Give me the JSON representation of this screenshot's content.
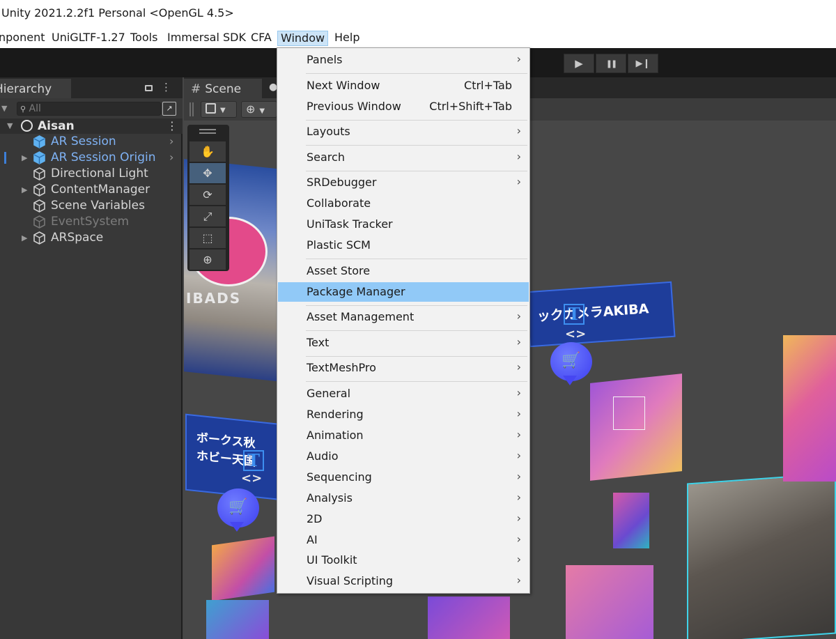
{
  "titlebar": {
    "title": "Unity 2021.2.2f1 Personal <OpenGL 4.5>"
  },
  "menubar": {
    "items": [
      "nponent",
      "UniGLTF-1.27",
      "Tools",
      "Immersal SDK",
      "CFA",
      "Window",
      "Help"
    ],
    "active": "Window"
  },
  "toolbar": {
    "play": "▶",
    "pause": "❚❚",
    "step": "▶❙"
  },
  "hierarchy": {
    "tab_label": "Hierarchy",
    "lock_icon": "lock-icon",
    "menu_icon": "⋮",
    "search_placeholder": "All",
    "scene_name": "Aisan",
    "items": [
      {
        "label": "AR Session",
        "style": "blue",
        "has_children": false,
        "has_chevron": true
      },
      {
        "label": "AR Session Origin",
        "style": "blue",
        "has_children": true,
        "has_chevron": true
      },
      {
        "label": "Directional Light",
        "style": "white",
        "has_children": false,
        "has_chevron": false
      },
      {
        "label": "ContentManager",
        "style": "white",
        "has_children": true,
        "has_chevron": false
      },
      {
        "label": "Scene Variables",
        "style": "white",
        "has_children": false,
        "has_chevron": false
      },
      {
        "label": "EventSystem",
        "style": "gray",
        "has_children": false,
        "has_chevron": false
      },
      {
        "label": "ARSpace",
        "style": "white",
        "has_children": true,
        "has_chevron": false
      }
    ]
  },
  "scene": {
    "tab_label": "Scene",
    "tab_icon": "#",
    "banner_akiba": "ックカメラAKIBA",
    "banner_hobby_line1": "ボークス秋",
    "banner_hobby_line2": "ホビー天国",
    "banner_left_text": "IBADS",
    "t_badge": "T",
    "arrows": "<>",
    "cart": "🛒"
  },
  "window_menu": {
    "items": [
      {
        "label": "Panels",
        "submenu": true,
        "sep_after": true
      },
      {
        "label": "Next Window",
        "shortcut": "Ctrl+Tab"
      },
      {
        "label": "Previous Window",
        "shortcut": "Ctrl+Shift+Tab",
        "sep_after": true
      },
      {
        "label": "Layouts",
        "submenu": true,
        "sep_after": true
      },
      {
        "label": "Search",
        "submenu": true,
        "sep_after": true
      },
      {
        "label": "SRDebugger",
        "submenu": true
      },
      {
        "label": "Collaborate"
      },
      {
        "label": "UniTask Tracker"
      },
      {
        "label": "Plastic SCM",
        "sep_after": true
      },
      {
        "label": "Asset Store"
      },
      {
        "label": "Package Manager",
        "highlighted": true,
        "sep_after": true
      },
      {
        "label": "Asset Management",
        "submenu": true,
        "sep_after": true
      },
      {
        "label": "Text",
        "submenu": true,
        "sep_after": true
      },
      {
        "label": "TextMeshPro",
        "submenu": true,
        "sep_after": true
      },
      {
        "label": "General",
        "submenu": true
      },
      {
        "label": "Rendering",
        "submenu": true
      },
      {
        "label": "Animation",
        "submenu": true
      },
      {
        "label": "Audio",
        "submenu": true
      },
      {
        "label": "Sequencing",
        "submenu": true
      },
      {
        "label": "Analysis",
        "submenu": true
      },
      {
        "label": "2D",
        "submenu": true
      },
      {
        "label": "AI",
        "submenu": true
      },
      {
        "label": "UI Toolkit",
        "submenu": true
      },
      {
        "label": "Visual Scripting",
        "submenu": true
      }
    ]
  },
  "colors": {
    "menu_highlight": "#91c9f7",
    "active_menu": "#cce4f7",
    "hierarchy_blue_text": "#7fb2f4"
  }
}
